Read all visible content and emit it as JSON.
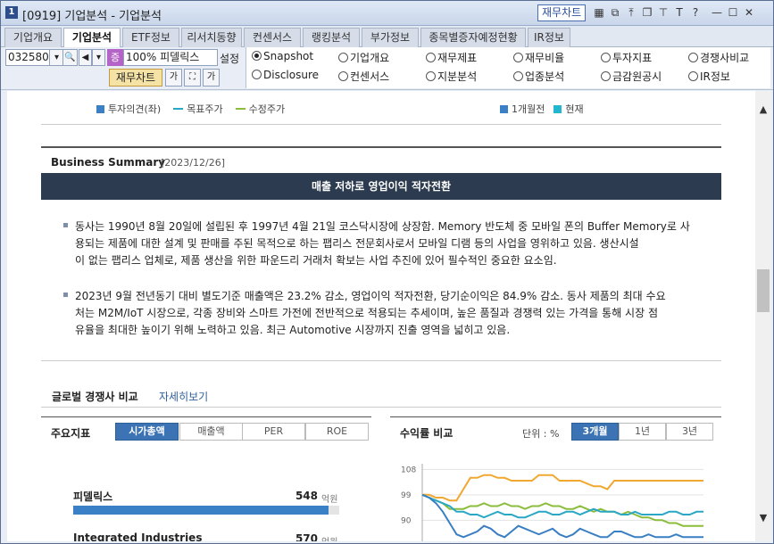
{
  "window": {
    "number": "1",
    "title": "[0919]  기업분석 - 기업분석",
    "finance_chart_button": "재무차트",
    "controls": [
      "grid-icon",
      "restore-icon",
      "pin-icon",
      "copy-icon",
      "push-pin-icon",
      "text-icon",
      "help-icon",
      "minimize-icon",
      "maximize-icon",
      "close-icon"
    ],
    "control_glyphs": [
      "▦",
      "⧉",
      "⤒",
      "❐",
      "⊤",
      "T",
      "?",
      "—",
      "☐",
      "✕"
    ]
  },
  "tabs": [
    "기업개요",
    "기업분석",
    "ETF정보",
    "리서치동향",
    "컨센서스",
    "랭킹분석",
    "부가정보",
    "종목별증자예정현황",
    "IR정보"
  ],
  "active_tab": "기업분석",
  "toolbar": {
    "code": "032580",
    "pct": "100%",
    "stock_name": "피델릭스",
    "setting": "설정",
    "finance_chart": "재무차트",
    "small_badge": "증"
  },
  "radios": [
    {
      "label": "Snapshot",
      "checked": true
    },
    {
      "label": "기업개요",
      "checked": false
    },
    {
      "label": "재무제표",
      "checked": false
    },
    {
      "label": "재무비율",
      "checked": false
    },
    {
      "label": "투자지표",
      "checked": false
    },
    {
      "label": "경쟁사비교",
      "checked": false
    },
    {
      "label": "Disclosure",
      "checked": false
    },
    {
      "label": "컨센서스",
      "checked": false
    },
    {
      "label": "지분분석",
      "checked": false
    },
    {
      "label": "업종분석",
      "checked": false
    },
    {
      "label": "금감원공시",
      "checked": false
    },
    {
      "label": "IR정보",
      "checked": false
    }
  ],
  "legend_top": {
    "left": [
      {
        "label": "투자의견(좌)",
        "color": "#3a80c6",
        "kind": "square"
      },
      {
        "label": "목표주가",
        "color": "#2aa7c5",
        "kind": "line"
      },
      {
        "label": "수정주가",
        "color": "#8bbd3c",
        "kind": "line"
      }
    ],
    "right": [
      {
        "label": "1개월전",
        "color": "#3a80c6"
      },
      {
        "label": "현재",
        "color": "#22b7cf"
      }
    ]
  },
  "business_summary": {
    "title": "Business Summary",
    "date": "[2023/12/26]",
    "banner": "매출 저하로 영업이익 적자전환",
    "para1_lines": [
      "동사는 1990년 8월 20일에 설립된 후 1997년 4월 21일 코스닥시장에 상장함. Memory 반도체 중 모바일 폰의 Buffer Memory로 사",
      "용되는 제품에 대한 설계 및 판매를 주된 목적으로 하는 팹리스 전문회사로서 모바일 디램 등의 사업을 영위하고 있음. 생산시설",
      "이 없는 팹리스 업체로, 제품 생산을 위한 파운드리 거래처 확보는 사업 추진에 있어 필수적인 중요한 요소임."
    ],
    "para2_lines": [
      "2023년 9월 전년동기 대비 별도기준 매출액은 23.2% 감소, 영업이익 적자전환, 당기순이익은 84.9% 감소. 동사 제품의 최대 수요",
      "처는 M2M/IoT 시장으로, 각종 장비와 스마트 가전에 전반적으로 적용되는 추세이며, 높은 품질과 경쟁력 있는 가격을 통해 시장 점",
      "유율을 최대한 높이기 위해 노력하고 있음. 최근 Automotive 시장까지 진출 영역을 넓히고 있음."
    ]
  },
  "global_compare": {
    "title": "글로벌 경쟁사 비교",
    "link": "자세히보기"
  },
  "key_metrics": {
    "title": "주요지표",
    "tabs": [
      "시가총액",
      "매출액",
      "PER",
      "ROE"
    ],
    "active": "시가총액",
    "rows": [
      {
        "name": "피델릭스",
        "value": "548",
        "unit": "억원",
        "fill_fraction": 0.96
      },
      {
        "name": "Integrated Industries",
        "value": "570",
        "unit": "억원",
        "fill_fraction": 1.0
      }
    ]
  },
  "returns": {
    "title": "수익률 비교",
    "unit_label": "단위 : %",
    "tabs": [
      "3개월",
      "1년",
      "3년"
    ],
    "active": "3개월"
  },
  "chart_data": {
    "type": "line",
    "title": "",
    "xlabel": "",
    "ylabel": "",
    "y_ticks": [
      108,
      99,
      90
    ],
    "ylim": [
      80,
      110
    ],
    "series": [
      {
        "color": "#f0a830",
        "values": [
          99,
          99,
          98,
          98,
          97,
          97,
          101,
          105,
          105,
          106,
          106,
          105,
          105,
          104,
          104,
          104,
          104,
          106,
          106,
          106,
          104,
          104,
          104,
          104,
          103,
          102,
          102,
          101,
          104,
          104,
          104,
          104,
          104,
          104,
          104,
          104,
          104,
          104,
          104,
          104,
          104,
          104
        ]
      },
      {
        "color": "#8bbd3c",
        "values": [
          99,
          98,
          97,
          96,
          94,
          94,
          94,
          95,
          95,
          96,
          95,
          95,
          96,
          95,
          95,
          94,
          95,
          95,
          96,
          95,
          95,
          94,
          94,
          95,
          94,
          93,
          94,
          93,
          93,
          92,
          93,
          92,
          91,
          91,
          90,
          90,
          89,
          89,
          88,
          88,
          88,
          88
        ]
      },
      {
        "color": "#2aa7c5",
        "values": [
          99,
          98,
          97,
          96,
          95,
          93,
          93,
          92,
          92,
          91,
          92,
          93,
          92,
          92,
          91,
          91,
          92,
          93,
          93,
          92,
          92,
          93,
          93,
          92,
          93,
          94,
          93,
          93,
          93,
          92,
          92,
          93,
          92,
          92,
          92,
          92,
          93,
          93,
          92,
          92,
          93,
          93
        ]
      },
      {
        "color": "#3a7fc4",
        "values": [
          99,
          98,
          96,
          93,
          89,
          85,
          84,
          85,
          86,
          88,
          87,
          85,
          84,
          86,
          88,
          87,
          86,
          85,
          86,
          87,
          85,
          84,
          85,
          87,
          86,
          85,
          84,
          84,
          86,
          86,
          85,
          84,
          84,
          85,
          84,
          84,
          84,
          85,
          84,
          84,
          84,
          84
        ]
      }
    ]
  }
}
